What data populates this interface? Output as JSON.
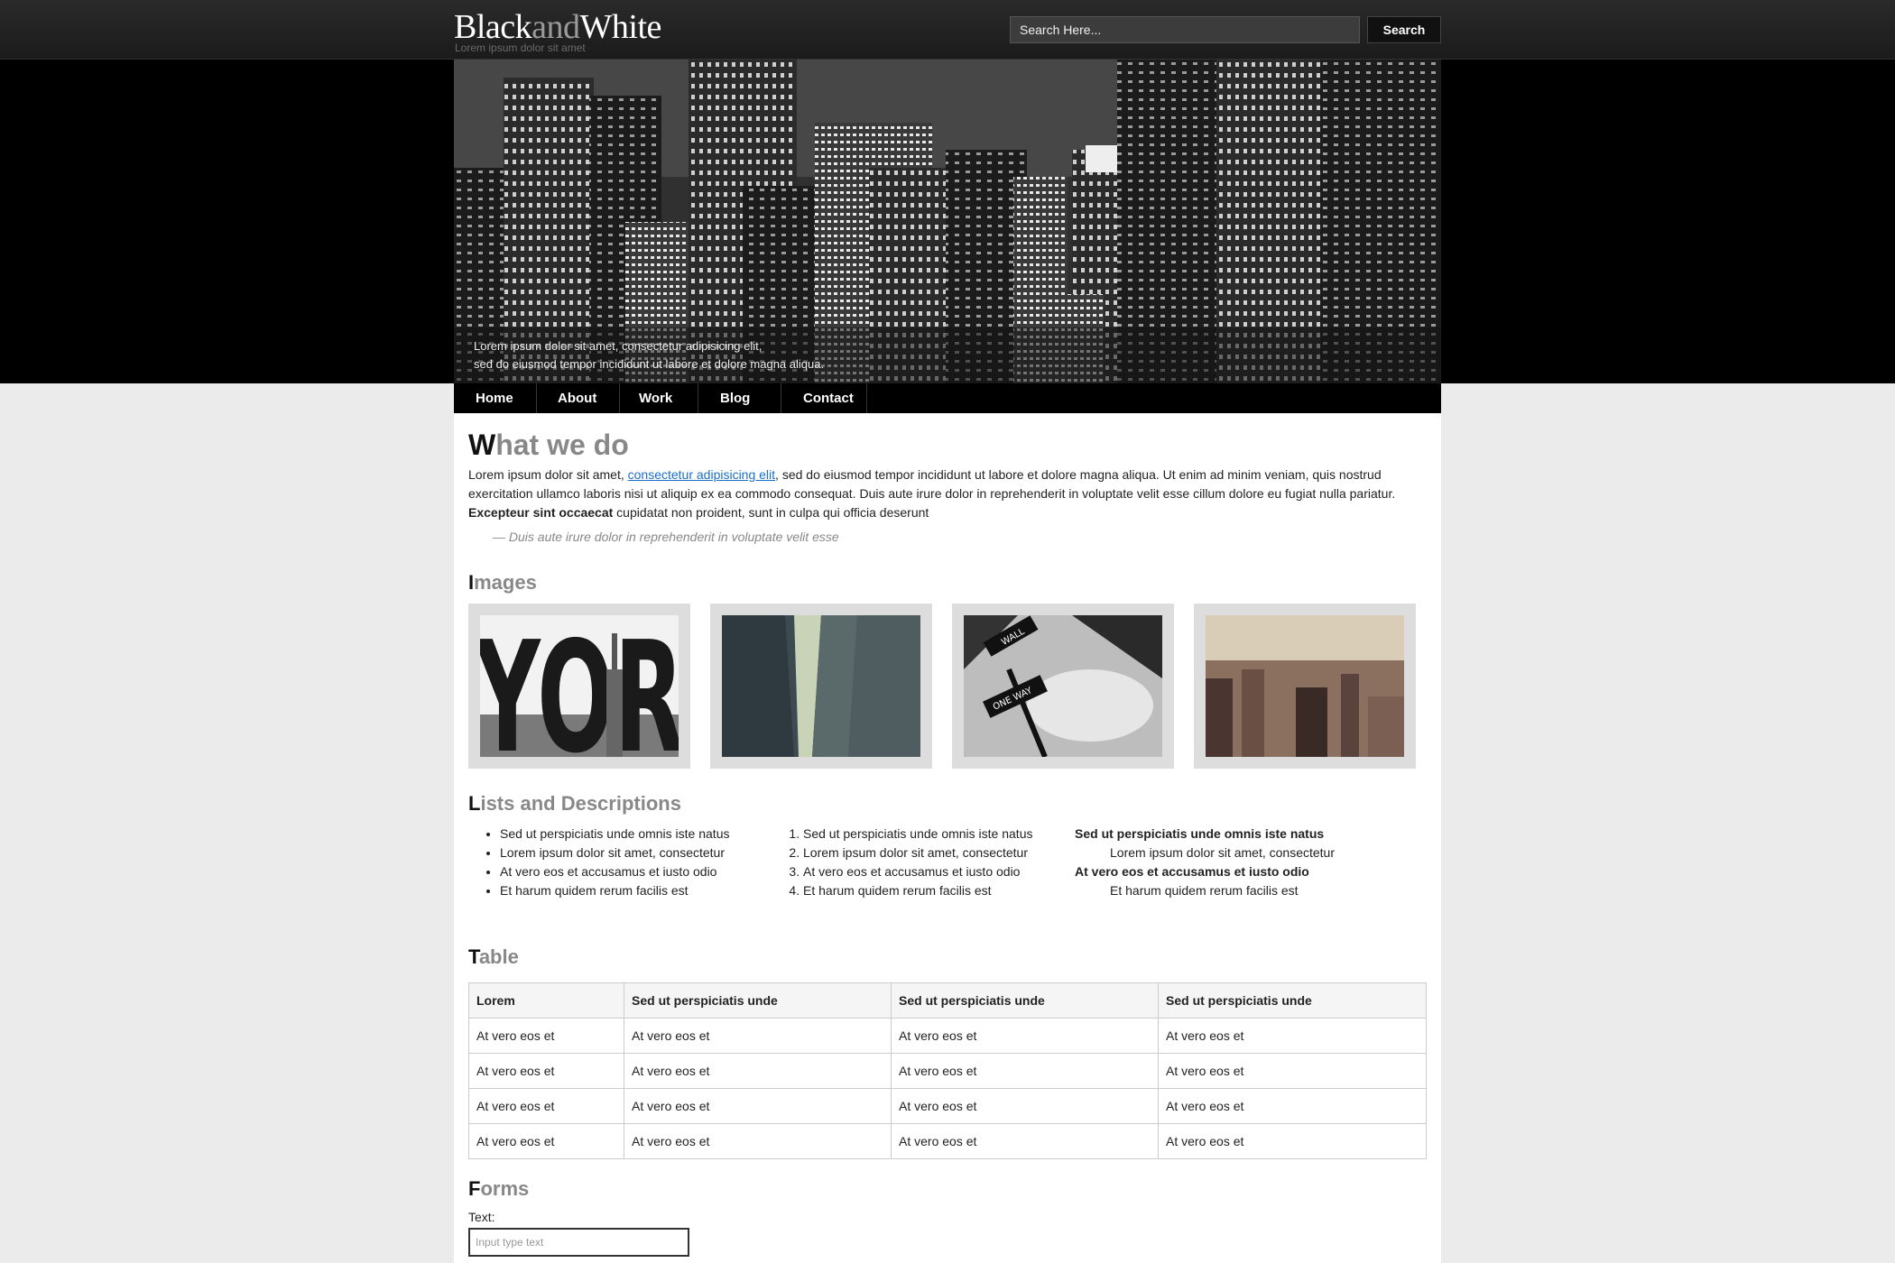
{
  "header": {
    "logo_part1": "Black",
    "logo_part2": "and",
    "logo_part3": "White",
    "tagline": "Lorem ipsum dolor sit amet",
    "search_placeholder": "Search Here...",
    "search_button": "Search"
  },
  "hero": {
    "caption_line1": "Lorem ipsum dolor sit amet, consectetur adipisicing elit,",
    "caption_line2": "sed do eiusmod tempor incididunt ut labore et dolore magna aliqua."
  },
  "nav": {
    "items": [
      "Home",
      "About",
      "Work",
      "Blog",
      "Contact"
    ]
  },
  "intro": {
    "title_first": "W",
    "title_rest": "hat we do",
    "text_start": "Lorem ipsum dolor sit amet, ",
    "link": "consectetur adipisicing elit",
    "text_mid": ", sed do eiusmod tempor incididunt ut labore et dolore magna aliqua. Ut enim ad minim veniam, quis nostrud exercitation ullamco laboris nisi ut aliquip ex ea commodo consequat. Duis aute irure dolor in reprehenderit in voluptate velit esse cillum dolore eu fugiat nulla pariatur. ",
    "text_bold": "Excepteur sint occaecat",
    "text_end": " cupidatat non proident, sunt in culpa qui officia deserunt",
    "quote": "— Duis aute irure dolor in reprehenderit in voluptate velit esse"
  },
  "images": {
    "title_first": "I",
    "title_rest": "mages",
    "yor_text": "YOR",
    "sign_text1": "WALL",
    "sign_text2": "ONE WAY"
  },
  "lists": {
    "title_first": "L",
    "title_rest": "ists and Descriptions",
    "unordered": [
      "Sed ut perspiciatis unde omnis iste natus",
      "Lorem ipsum dolor sit amet, consectetur",
      "At vero eos et accusamus et iusto odio",
      "Et harum quidem rerum facilis est"
    ],
    "ordered": [
      "Sed ut perspiciatis unde omnis iste natus",
      "Lorem ipsum dolor sit amet, consectetur",
      "At vero eos et accusamus et iusto odio",
      "Et harum quidem rerum facilis est"
    ],
    "definitions": [
      {
        "term": "Sed ut perspiciatis unde omnis iste natus",
        "desc": "Lorem ipsum dolor sit amet, consectetur"
      },
      {
        "term": "At vero eos et accusamus et iusto odio",
        "desc": "Et harum quidem rerum facilis est"
      }
    ]
  },
  "table": {
    "title_first": "T",
    "title_rest": "able",
    "headers": [
      "Lorem",
      "Sed ut perspiciatis unde",
      "Sed ut perspiciatis unde",
      "Sed ut perspiciatis unde"
    ],
    "rows": [
      [
        "At vero eos et",
        "At vero eos et",
        "At vero eos et",
        "At vero eos et"
      ],
      [
        "At vero eos et",
        "At vero eos et",
        "At vero eos et",
        "At vero eos et"
      ],
      [
        "At vero eos et",
        "At vero eos et",
        "At vero eos et",
        "At vero eos et"
      ],
      [
        "At vero eos et",
        "At vero eos et",
        "At vero eos et",
        "At vero eos et"
      ]
    ]
  },
  "forms": {
    "title_first": "F",
    "title_rest": "orms",
    "text_label": "Text:",
    "text_placeholder": "Input type text"
  }
}
